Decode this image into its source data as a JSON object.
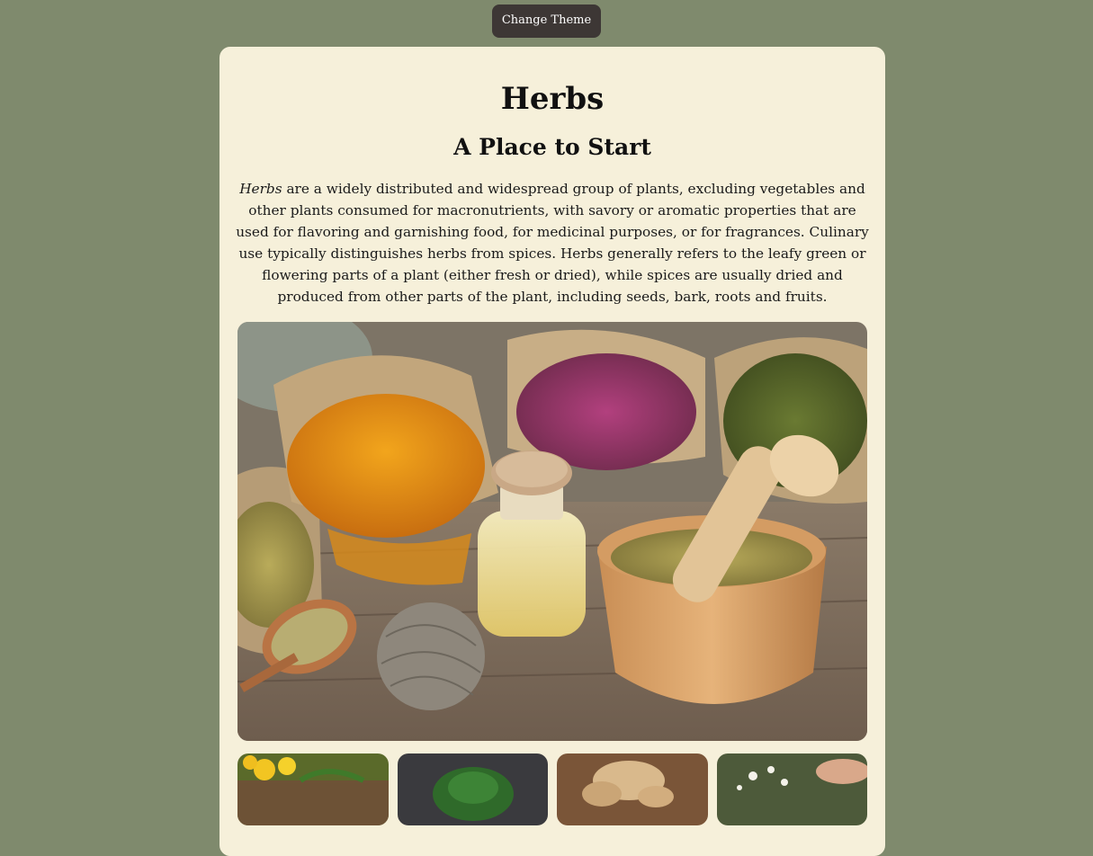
{
  "toolbar": {
    "change_theme_label": "Change Theme"
  },
  "header": {
    "title": "Herbs",
    "subtitle": "A Place to Start"
  },
  "intro": {
    "lead_word": "Herbs",
    "text": " are a widely distributed and widespread group of plants, excluding vegetables and other plants consumed for macronutrients, with savory or aromatic properties that are used for flavoring and garnishing food, for medicinal purposes, or for fragrances. Culinary use typically distinguishes herbs from spices. Herbs generally refers to the leafy green or flowering parts of a plant (either fresh or dried), while spices are usually dried and produced from other parts of the plant, including seeds, bark, roots and fruits."
  },
  "colors": {
    "page_background": "#7f8a6d",
    "card_background": "#f6f0da",
    "button_background": "#3d3735"
  },
  "images": {
    "hero": "dried-herbs-in-burlap-sacks-with-mortar-and-oil-bottle",
    "thumbnails": [
      "dandelion-flowers",
      "fresh-nettle-leaves",
      "ginger-root",
      "chamomile-picking"
    ]
  }
}
